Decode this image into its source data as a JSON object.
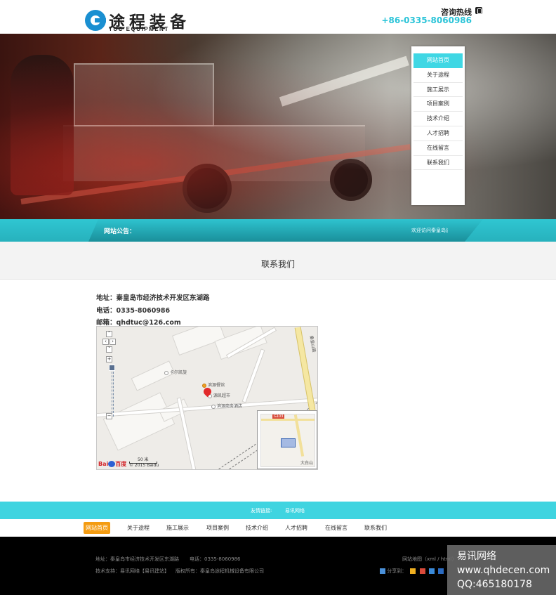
{
  "header": {
    "logo_cn": "途程装备",
    "logo_en": "TUC EQUIPMENT",
    "hotline_label": "咨询热线",
    "hotline_number": "+86-0335-8060986"
  },
  "side_menu": {
    "items": [
      {
        "label": "网站首页",
        "active": true
      },
      {
        "label": "关于途程",
        "active": false
      },
      {
        "label": "施工展示",
        "active": false
      },
      {
        "label": "项目案例",
        "active": false
      },
      {
        "label": "技术介绍",
        "active": false
      },
      {
        "label": "人才招聘",
        "active": false
      },
      {
        "label": "在线留言",
        "active": false
      },
      {
        "label": "联系我们",
        "active": false
      }
    ]
  },
  "notice": {
    "label": "网站公告：",
    "text": "欢迎访问秦皇岛途程"
  },
  "section": {
    "title": "联系我们"
  },
  "contact": {
    "address": "地址：秦皇岛市经济技术开发区东湖路",
    "phone": "电话：0335-8060986",
    "email": "邮箱：qhdtuc@126.com"
  },
  "map": {
    "poi_1": "卡尔凯旋",
    "poi_2": "滨源餐馆",
    "poi_3": "源凯超市",
    "poi_4": "滨源商务酒店",
    "road_label": "秦皇山路",
    "scale": "50 米",
    "brand": "Bai",
    "brand_cn": "百度",
    "copyright": "© 2015 Baidu",
    "minimap_badge": "G103",
    "minimap_label": "大白山"
  },
  "links": {
    "label": "友情链接:",
    "item": "易讯网络"
  },
  "footer_nav": {
    "items": [
      {
        "label": "网站首页",
        "active": true
      },
      {
        "label": "关于途程",
        "active": false
      },
      {
        "label": "施工展示",
        "active": false
      },
      {
        "label": "项目案例",
        "active": false
      },
      {
        "label": "技术介绍",
        "active": false
      },
      {
        "label": "人才招聘",
        "active": false
      },
      {
        "label": "在线留言",
        "active": false
      },
      {
        "label": "联系我们",
        "active": false
      }
    ]
  },
  "footer": {
    "address": "地址：秦皇岛市经济技术开发区东湖路",
    "phone": "电话：0335-8060986",
    "sitemap": "网站地图（xml / html）",
    "support": "技术支持：易讯网络【易讯建站】",
    "copyright": "版权所有：秦皇岛途程机械设备有限公司",
    "share_label": "分享到："
  },
  "watermark": {
    "line1": "易讯网络",
    "line2": "www.qhdecen.com",
    "line3": "QQ:465180178"
  },
  "colors": {
    "accent": "#3fd4e0",
    "active_nav": "#f49c12",
    "phone_number": "#2bc4d8"
  }
}
